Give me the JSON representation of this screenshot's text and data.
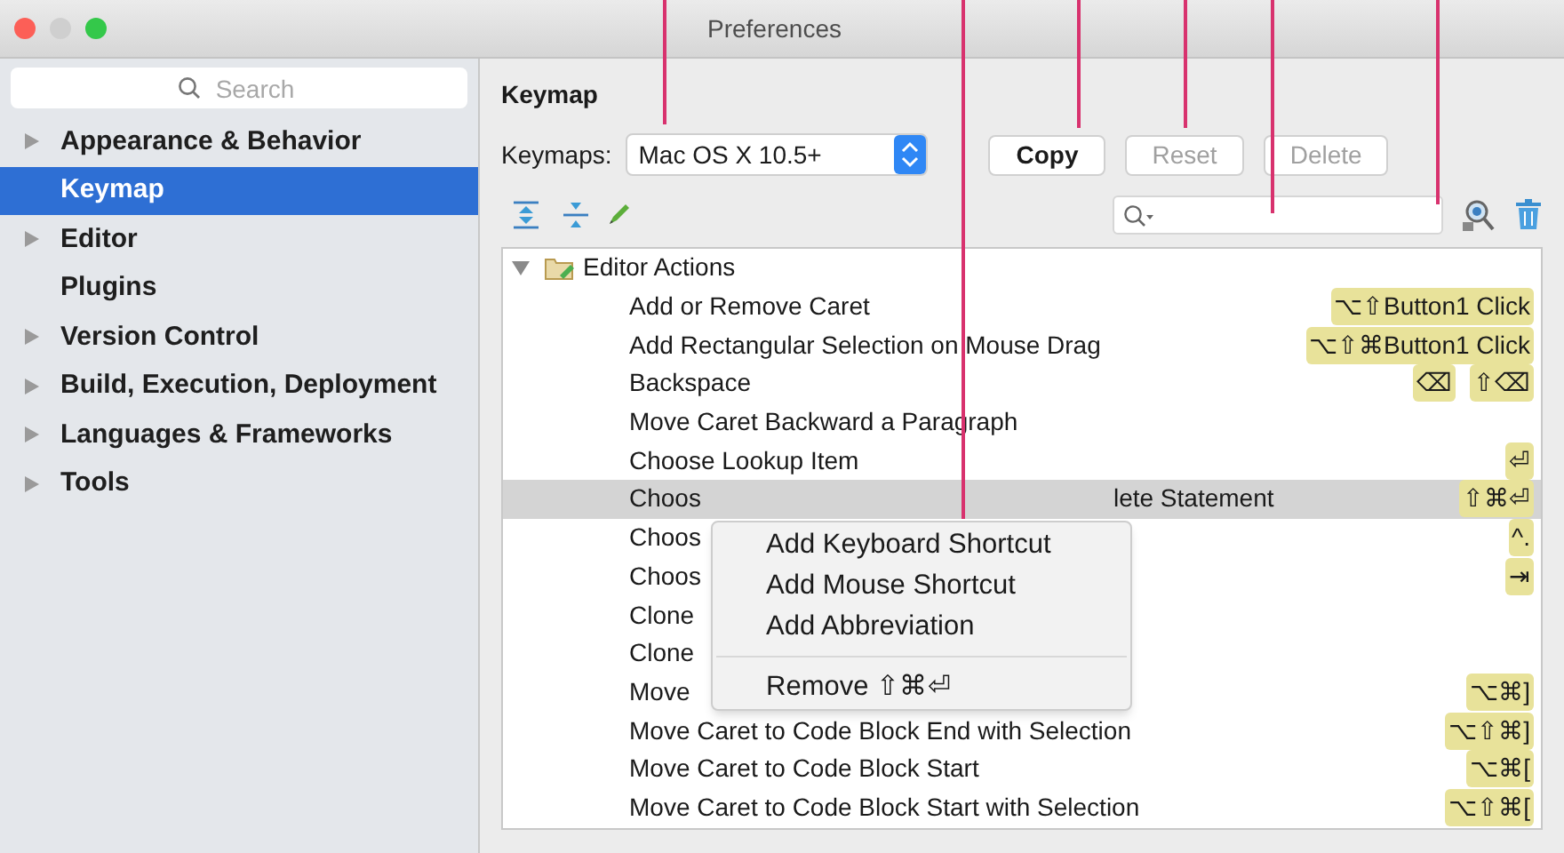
{
  "window": {
    "title": "Preferences"
  },
  "sidebar": {
    "search": {
      "placeholder": "Search"
    },
    "items": [
      {
        "label": "Appearance & Behavior",
        "expandable": true,
        "selected": false
      },
      {
        "label": "Keymap",
        "expandable": false,
        "selected": true
      },
      {
        "label": "Editor",
        "expandable": true,
        "selected": false
      },
      {
        "label": "Plugins",
        "expandable": false,
        "selected": false
      },
      {
        "label": "Version Control",
        "expandable": true,
        "selected": false
      },
      {
        "label": "Build, Execution, Deployment",
        "expandable": true,
        "selected": false
      },
      {
        "label": "Languages & Frameworks",
        "expandable": true,
        "selected": false
      },
      {
        "label": "Tools",
        "expandable": true,
        "selected": false
      }
    ]
  },
  "panel": {
    "title": "Keymap",
    "keymap_label": "Keymaps:",
    "keymap_value": "Mac OS X 10.5+",
    "buttons": [
      {
        "label": "Copy",
        "disabled": false
      },
      {
        "label": "Reset",
        "disabled": true
      },
      {
        "label": "Delete",
        "disabled": true
      }
    ]
  },
  "tree": {
    "root": {
      "label": "Editor Actions",
      "expanded": true
    },
    "rows": [
      {
        "name": "Add or Remove Caret",
        "shortcuts": [
          "⌥⇧Button1 Click"
        ],
        "selected": false
      },
      {
        "name": "Add Rectangular Selection on Mouse Drag",
        "shortcuts": [
          "⌥⇧⌘Button1 Click"
        ],
        "selected": false
      },
      {
        "name": "Backspace",
        "shortcuts": [
          "⌫",
          "⇧⌫"
        ],
        "selected": false
      },
      {
        "name": "Move Caret Backward a Paragraph",
        "selected": false
      },
      {
        "name": "Choose Lookup Item",
        "shortcuts": [
          "⏎"
        ],
        "selected": false
      },
      {
        "name": "Choos",
        "name_tail": "lete Statement",
        "shortcuts": [
          "⇧⌘⏎"
        ],
        "selected": true
      },
      {
        "name": "Choos",
        "shortcuts": [
          "^."
        ],
        "selected": false
      },
      {
        "name": "Choos",
        "shortcuts": [
          "⇥"
        ],
        "selected": false
      },
      {
        "name": "Clone",
        "selected": false
      },
      {
        "name": "Clone",
        "selected": false
      },
      {
        "name": "Move",
        "shortcuts": [
          "⌥⌘]"
        ],
        "selected": false
      },
      {
        "name": "Move Caret to Code Block End with Selection",
        "shortcuts": [
          "⌥⇧⌘]"
        ],
        "selected": false
      },
      {
        "name": "Move Caret to Code Block Start",
        "shortcuts": [
          "⌥⌘["
        ],
        "selected": false
      },
      {
        "name": "Move Caret to Code Block Start with Selection",
        "shortcuts": [
          "⌥⇧⌘["
        ],
        "selected": false
      }
    ]
  },
  "context_menu": {
    "items": [
      {
        "kind": "item",
        "label": "Add Keyboard Shortcut"
      },
      {
        "kind": "item",
        "label": "Add Mouse Shortcut"
      },
      {
        "kind": "item",
        "label": "Add Abbreviation"
      },
      {
        "kind": "separator"
      },
      {
        "kind": "item",
        "label": "Remove ⇧⌘⏎"
      }
    ]
  }
}
